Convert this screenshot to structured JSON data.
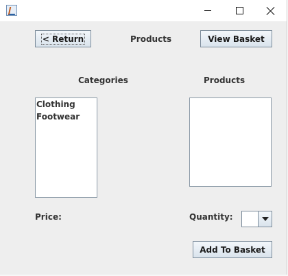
{
  "window": {
    "icon": "java-app-icon",
    "controls": [
      "minimize-icon",
      "maximize-icon",
      "close-icon"
    ]
  },
  "toolbar": {
    "return_label": "< Return",
    "title": "Products",
    "basket_label": "View Basket"
  },
  "categories": {
    "heading": "Categories",
    "items": [
      "Clothing",
      "Footwear"
    ]
  },
  "products": {
    "heading": "Products",
    "items": []
  },
  "price": {
    "label": "Price:",
    "value": ""
  },
  "quantity": {
    "label": "Quantity:",
    "value": ""
  },
  "add_label": "Add To Basket",
  "colors": {
    "window_bg": "#eeeeee",
    "button_border": "#7a8a99",
    "list_border": "#8a99a6"
  }
}
